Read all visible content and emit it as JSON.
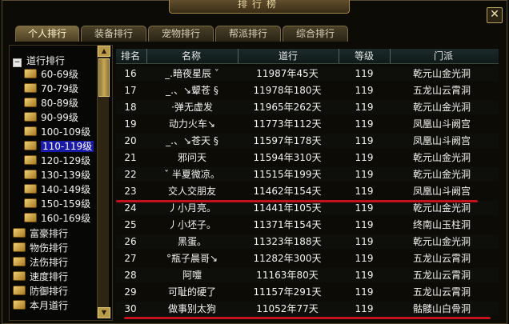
{
  "window": {
    "title": "排行榜",
    "close_label": "✕"
  },
  "tabs": [
    {
      "label": "个人排行",
      "active": true
    },
    {
      "label": "装备排行",
      "active": false
    },
    {
      "label": "宠物排行",
      "active": false
    },
    {
      "label": "帮派排行",
      "active": false
    },
    {
      "label": "综合排行",
      "active": false
    }
  ],
  "tree": {
    "root_label": "道行排行",
    "children": [
      "60-69级",
      "70-79级",
      "80-89级",
      "90-99级",
      "100-109级",
      "110-119级",
      "120-129级",
      "130-139级",
      "140-149级",
      "150-159级",
      "160-169级"
    ],
    "selected_child": "110-119级",
    "others": [
      "富豪排行",
      "物伤排行",
      "法伤排行",
      "速度排行",
      "防御排行",
      "本月道行"
    ]
  },
  "table": {
    "headers": {
      "rank": "排名",
      "name": "名称",
      "score": "道行",
      "level": "等级",
      "faction": "门派"
    },
    "rows": [
      {
        "rank": "16",
        "name": "_.暗夜星辰 ˇ",
        "score": "11987年45天",
        "level": "119",
        "faction": "乾元山金光洞"
      },
      {
        "rank": "17",
        "name": "_.、↘颦苍 § ",
        "score": "11978年180天",
        "level": "119",
        "faction": "五龙山云霄洞"
      },
      {
        "rank": "18",
        "name": "·弹无虚发",
        "score": "11965年262天",
        "level": "119",
        "faction": "乾元山金光洞"
      },
      {
        "rank": "19",
        "name": "动力火车↘",
        "score": "11773年112天",
        "level": "119",
        "faction": "凤凰山斗阙宫"
      },
      {
        "rank": "20",
        "name": "_.、↘苍天 § ",
        "score": "11597年178天",
        "level": "119",
        "faction": "凤凰山斗阙宫"
      },
      {
        "rank": "21",
        "name": "邪问天",
        "score": "11594年310天",
        "level": "119",
        "faction": "乾元山金光洞"
      },
      {
        "rank": "22",
        "name": "ˇ 半夏微凉。",
        "score": "11515年199天",
        "level": "119",
        "faction": "乾元山金光洞"
      },
      {
        "rank": "23",
        "name": "交人交朋友",
        "score": "11462年154天",
        "level": "119",
        "faction": "凤凰山斗阙宫"
      },
      {
        "rank": "24",
        "name": "丿小月亮。",
        "score": "11441年105天",
        "level": "119",
        "faction": "乾元山金光洞"
      },
      {
        "rank": "25",
        "name": "丿小坯子。",
        "score": "11371年154天",
        "level": "119",
        "faction": "终南山玉柱洞"
      },
      {
        "rank": "26",
        "name": "黑蛋。",
        "score": "11323年188天",
        "level": "119",
        "faction": "乾元山金光洞"
      },
      {
        "rank": "27",
        "name": "°瓶子晨哥↘",
        "score": "11282年300天",
        "level": "119",
        "faction": "五龙山云霄洞"
      },
      {
        "rank": "28",
        "name": "阿嚏",
        "score": "11163年80天",
        "level": "119",
        "faction": "五龙山云霄洞"
      },
      {
        "rank": "29",
        "name": "可耻的硬了",
        "score": "11157年291天",
        "level": "119",
        "faction": "五龙山云霄洞"
      },
      {
        "rank": "30",
        "name": "做事别太狗",
        "score": "11052年77天",
        "level": "119",
        "faction": "骷髅山白骨洞"
      }
    ]
  },
  "colors": {
    "highlight_line": "#c4121c",
    "selection": "#1a1aa8"
  }
}
